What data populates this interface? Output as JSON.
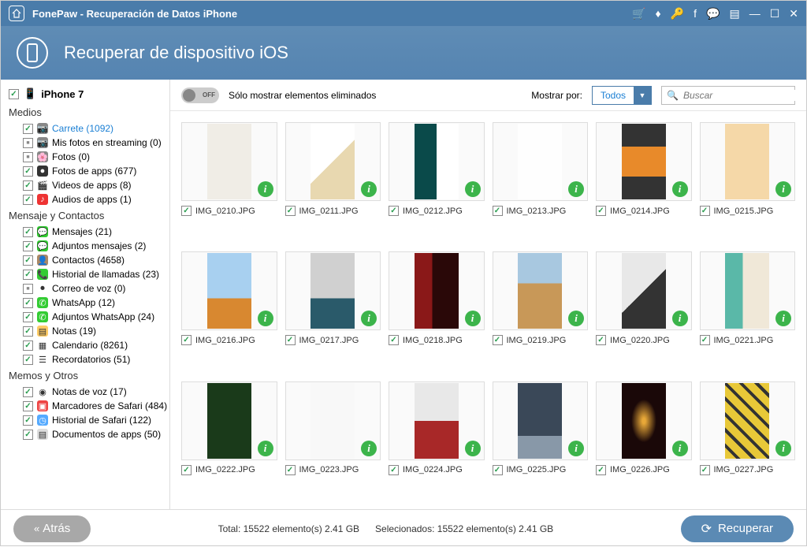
{
  "titlebar": {
    "title": "FonePaw - Recuperación de Datos iPhone"
  },
  "header": {
    "title": "Recuperar de dispositivo iOS"
  },
  "device": {
    "name": "iPhone 7"
  },
  "toolbar": {
    "toggle_off": "OFF",
    "toggle_label": "Sólo mostrar elementos eliminados",
    "show_by_label": "Mostrar por:",
    "show_by_value": "Todos",
    "search_placeholder": "Buscar"
  },
  "sidebar": {
    "sections": [
      {
        "title": "Medios",
        "items": [
          {
            "label": "Carrete (1092)",
            "checked": true,
            "active": true,
            "icon": "📷",
            "bg": "#888"
          },
          {
            "label": "Mis fotos en streaming (0)",
            "checked": false,
            "ind": true,
            "icon": "📷",
            "bg": "#888"
          },
          {
            "label": "Fotos (0)",
            "checked": false,
            "ind": true,
            "icon": "🌸",
            "bg": "#888"
          },
          {
            "label": "Fotos de apps (677)",
            "checked": true,
            "icon": "●",
            "bg": "#333"
          },
          {
            "label": "Videos de apps (8)",
            "checked": true,
            "icon": "🎬",
            "bg": "#fff"
          },
          {
            "label": "Audios de apps (1)",
            "checked": true,
            "icon": "♪",
            "bg": "#e33"
          }
        ]
      },
      {
        "title": "Mensaje y Contactos",
        "items": [
          {
            "label": "Mensajes (21)",
            "checked": true,
            "icon": "💬",
            "bg": "#3c3"
          },
          {
            "label": "Adjuntos mensajes (2)",
            "checked": true,
            "icon": "💬",
            "bg": "#3c3"
          },
          {
            "label": "Contactos (4658)",
            "checked": true,
            "icon": "👤",
            "bg": "#a86"
          },
          {
            "label": "Historial de llamadas (23)",
            "checked": true,
            "icon": "📞",
            "bg": "#3c3"
          },
          {
            "label": "Correo de voz (0)",
            "checked": false,
            "ind": true,
            "icon": "⏺",
            "bg": "#fff"
          },
          {
            "label": "WhatsApp (12)",
            "checked": true,
            "icon": "✆",
            "bg": "#3c3"
          },
          {
            "label": "Adjuntos WhatsApp (24)",
            "checked": true,
            "icon": "✆",
            "bg": "#3c3"
          },
          {
            "label": "Notas (19)",
            "checked": true,
            "icon": "▤",
            "bg": "#fc6"
          },
          {
            "label": "Calendario (8261)",
            "checked": true,
            "icon": "▦",
            "bg": "#fff"
          },
          {
            "label": "Recordatorios (51)",
            "checked": true,
            "icon": "☰",
            "bg": "#fff"
          }
        ]
      },
      {
        "title": "Memos y Otros",
        "items": [
          {
            "label": "Notas de voz (17)",
            "checked": true,
            "icon": "◉",
            "bg": "#fff"
          },
          {
            "label": "Marcadores de Safari (484)",
            "checked": true,
            "icon": "▣",
            "bg": "#e44"
          },
          {
            "label": "Historial de Safari (122)",
            "checked": true,
            "icon": "◷",
            "bg": "#5af"
          },
          {
            "label": "Documentos de apps (50)",
            "checked": true,
            "icon": "▤",
            "bg": "#ddd"
          }
        ]
      }
    ]
  },
  "grid": {
    "items": [
      {
        "name": "IMG_0210.JPG",
        "cls": "t0"
      },
      {
        "name": "IMG_0211.JPG",
        "cls": "t1"
      },
      {
        "name": "IMG_0212.JPG",
        "cls": "t2"
      },
      {
        "name": "IMG_0213.JPG",
        "cls": "t3"
      },
      {
        "name": "IMG_0214.JPG",
        "cls": "t4"
      },
      {
        "name": "IMG_0215.JPG",
        "cls": "t5"
      },
      {
        "name": "IMG_0216.JPG",
        "cls": "t6"
      },
      {
        "name": "IMG_0217.JPG",
        "cls": "t7"
      },
      {
        "name": "IMG_0218.JPG",
        "cls": "t8"
      },
      {
        "name": "IMG_0219.JPG",
        "cls": "t9"
      },
      {
        "name": "IMG_0220.JPG",
        "cls": "t10"
      },
      {
        "name": "IMG_0221.JPG",
        "cls": "t11"
      },
      {
        "name": "IMG_0222.JPG",
        "cls": "t12"
      },
      {
        "name": "IMG_0223.JPG",
        "cls": "t13"
      },
      {
        "name": "IMG_0224.JPG",
        "cls": "t14"
      },
      {
        "name": "IMG_0225.JPG",
        "cls": "t15"
      },
      {
        "name": "IMG_0226.JPG",
        "cls": "t16"
      },
      {
        "name": "IMG_0227.JPG",
        "cls": "t17"
      }
    ]
  },
  "footer": {
    "back": "Atrás",
    "total": "Total: 15522 elemento(s) 2.41 GB",
    "selected": "Selecionados: 15522 elemento(s) 2.41 GB",
    "recover": "Recuperar"
  }
}
